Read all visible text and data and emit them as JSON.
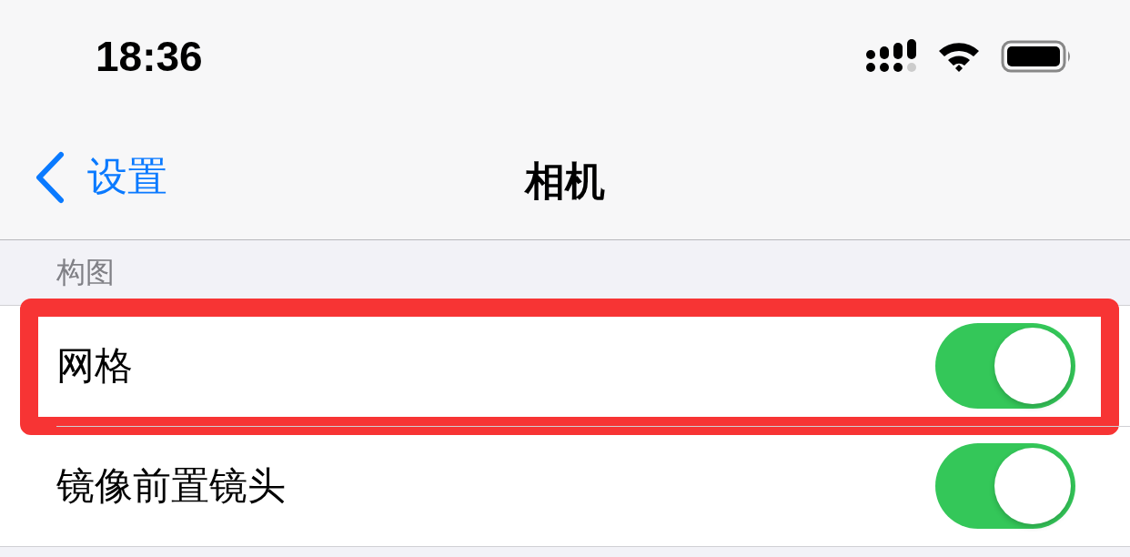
{
  "status_bar": {
    "time": "18:36"
  },
  "nav_bar": {
    "back_label": "设置",
    "title": "相机"
  },
  "section": {
    "header": "构图",
    "rows": [
      {
        "label": "网格",
        "on": true,
        "highlighted": true
      },
      {
        "label": "镜像前置镜头",
        "on": true,
        "highlighted": false
      }
    ]
  }
}
